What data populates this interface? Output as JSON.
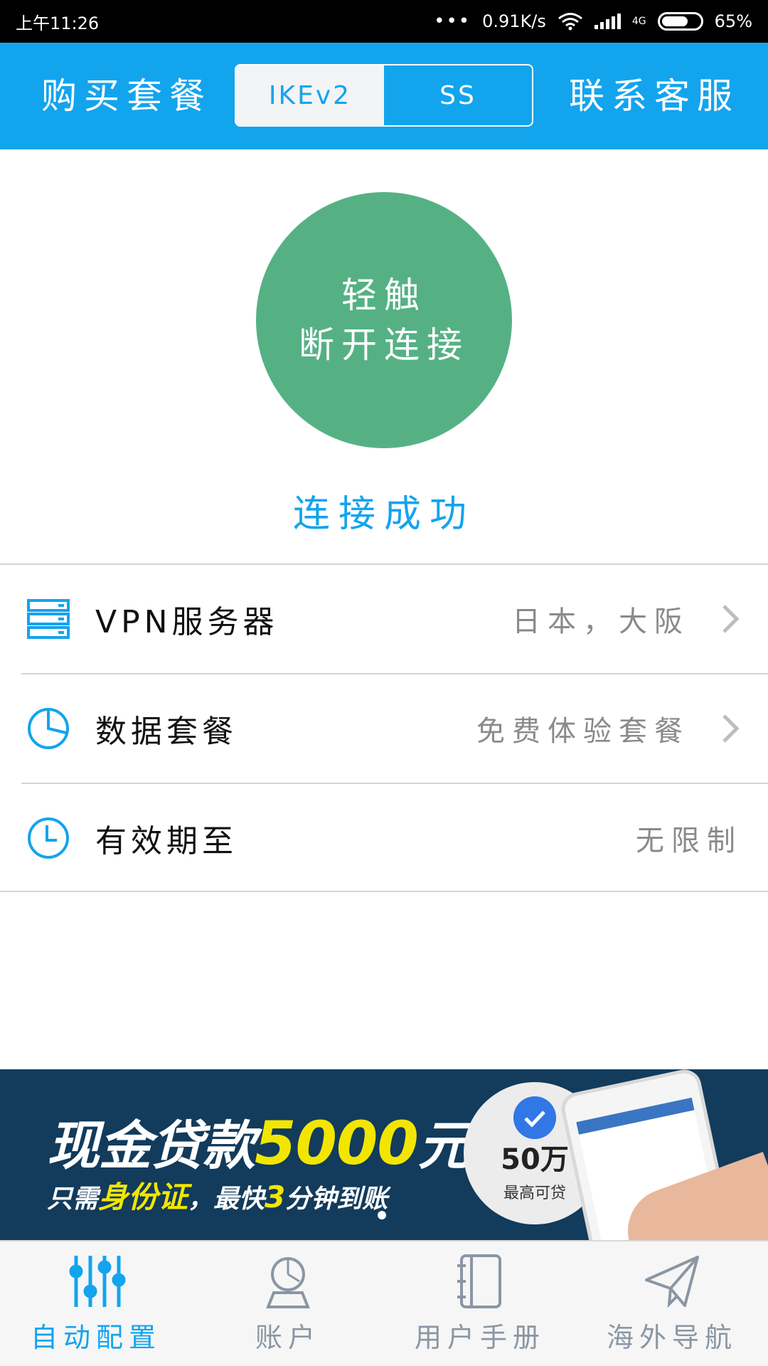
{
  "status_bar": {
    "time": "上午11:26",
    "dots": "•••",
    "speed": "0.91K/s",
    "network_type": "4G",
    "battery": "65%"
  },
  "header": {
    "buy_label": "购买套餐",
    "contact_label": "联系客服",
    "protocol_tabs": [
      {
        "label": "IKEv2",
        "selected": true
      },
      {
        "label": "SS",
        "selected": false
      }
    ]
  },
  "connect": {
    "button_line1": "轻触",
    "button_line2": "断开连接",
    "status_text": "连接成功",
    "button_color": "#55b184"
  },
  "info_rows": [
    {
      "icon": "server-icon",
      "label": "VPN服务器",
      "value": "日本，大阪",
      "has_arrow": true
    },
    {
      "icon": "pie-chart-icon",
      "label": "数据套餐",
      "value": "免费体验套餐",
      "has_arrow": true
    },
    {
      "icon": "clock-icon",
      "label": "有效期至",
      "value": "无限制",
      "has_arrow": false
    }
  ],
  "banner": {
    "line1_prefix": "现金贷款",
    "line1_amount": "5000",
    "line1_suffix": "元",
    "line2_prefix": "只需",
    "line2_highlight": "身份证",
    "line2_mid": "，最快",
    "line2_number": "3",
    "line2_suffix": "分钟到账",
    "badge_amount": "50万",
    "badge_sub": "最高可贷",
    "page_count": 1,
    "active_page": 0
  },
  "tab_bar": {
    "items": [
      {
        "icon": "sliders-icon",
        "label": "自动配置",
        "active": true
      },
      {
        "icon": "account-icon",
        "label": "账户",
        "active": false
      },
      {
        "icon": "manual-book-icon",
        "label": "用户手册",
        "active": false
      },
      {
        "icon": "paper-plane-icon",
        "label": "海外导航",
        "active": false
      }
    ]
  },
  "colors": {
    "accent": "#13a4ee",
    "connected_green": "#55b184",
    "banner_bg": "#123b5c",
    "banner_highlight": "#f2e600",
    "inactive_tab": "#8a96a3"
  }
}
